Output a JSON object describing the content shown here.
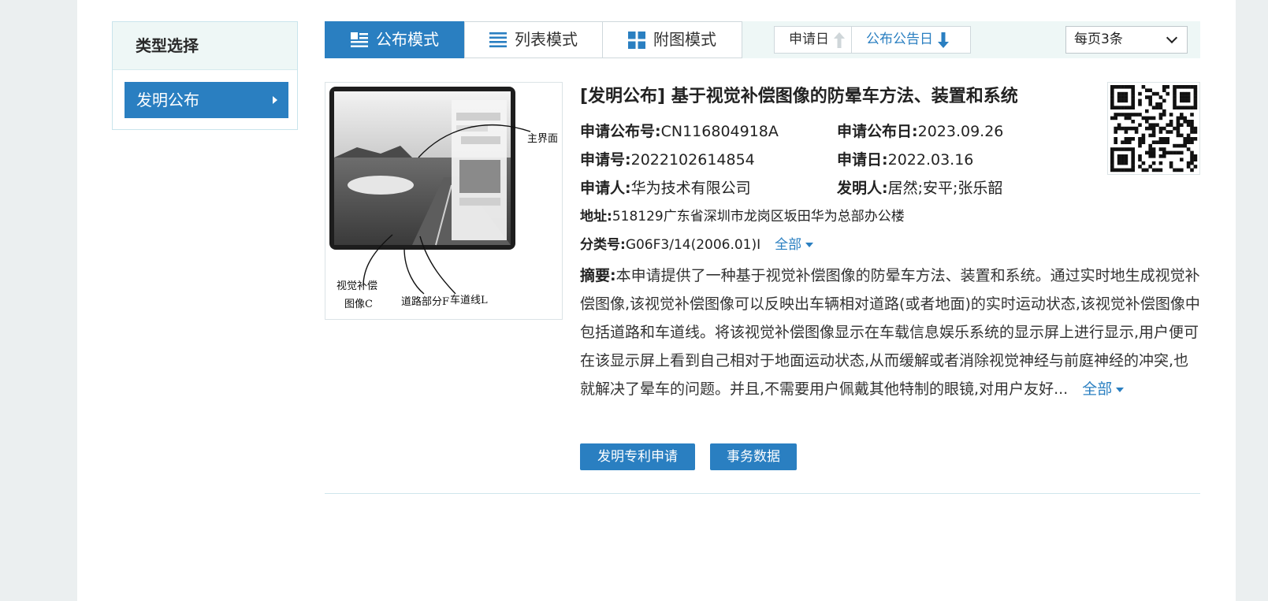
{
  "sidebar": {
    "heading": "类型选择",
    "items": [
      {
        "label": "发明公布",
        "active": true
      }
    ]
  },
  "toolbar": {
    "modes": [
      {
        "label": "公布模式",
        "icon": "publication-list-icon",
        "active": true
      },
      {
        "label": "列表模式",
        "icon": "list-icon",
        "active": false
      },
      {
        "label": "附图模式",
        "icon": "grid-icon",
        "active": false
      }
    ],
    "sort": [
      {
        "label": "申请日",
        "icon": "arrow-up-icon",
        "active": false
      },
      {
        "label": "公布公告日",
        "icon": "arrow-down-icon",
        "active": true
      }
    ],
    "per_page": {
      "selected": "每页3条"
    }
  },
  "result": {
    "title": "[发明公布] 基于视觉补偿图像的防晕车方法、装置和系统",
    "pub_no_label": "申请公布号:",
    "pub_no": "CN116804918A",
    "pub_date_label": "申请公布日:",
    "pub_date": "2023.09.26",
    "app_no_label": "申请号:",
    "app_no": "2022102614854",
    "app_date_label": "申请日:",
    "app_date": "2022.03.16",
    "applicant_label": "申请人:",
    "applicant": "华为技术有限公司",
    "inventor_label": "发明人:",
    "inventor": "居然;安平;张乐韶",
    "address_label": "地址:",
    "address": "518129广东省深圳市龙岗区坂田华为总部办公楼",
    "class_label": "分类号:",
    "class_no": "G06F3/14(2006.01)I",
    "class_more": "全部",
    "abstract_label": "摘要:",
    "abstract": "本申请提供了一种基于视觉补偿图像的防晕车方法、装置和系统。通过实时地生成视觉补偿图像,该视觉补偿图像可以反映出车辆相对道路(或者地面)的实时运动状态,该视觉补偿图像中包括道路和车道线。将该视觉补偿图像显示在车载信息娱乐系统的显示屏上进行显示,用户便可在该显示屏上看到自己相对于地面运动状态,从而缓解或者消除视觉神经与前庭神经的冲突,也就解决了晕车的问题。并且,不需要用户佩戴其他特制的眼镜,对用户友好...",
    "abstract_more": "全部",
    "figure_labels": {
      "main_ui": "主界面",
      "comp_image_1": "视觉补偿",
      "comp_image_2": "图像C",
      "road_part": "道路部分F",
      "lane_line": "车道线L"
    },
    "actions": [
      {
        "label": "发明专利申请"
      },
      {
        "label": "事务数据"
      }
    ]
  },
  "colors": {
    "accent": "#2a7fc1",
    "page_bg": "#ebeff0",
    "panel_bg": "#eef7f6"
  }
}
